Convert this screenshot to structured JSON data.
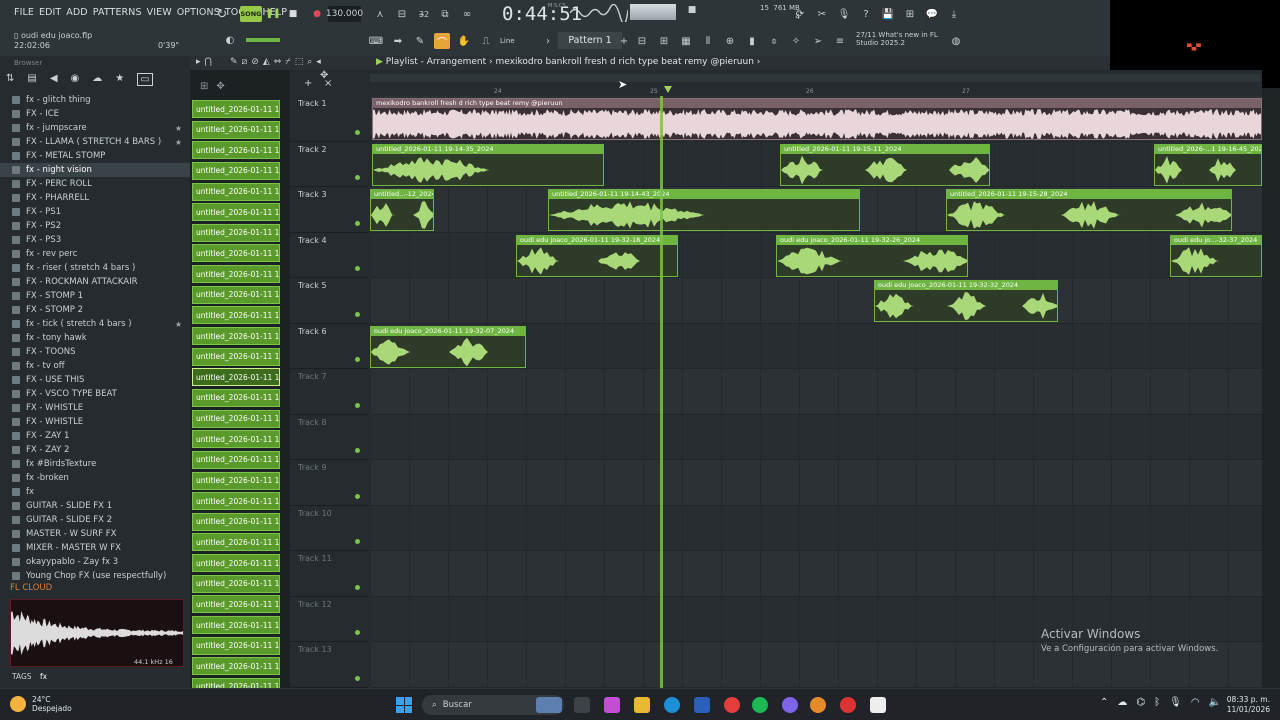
{
  "menu": [
    "FILE",
    "EDIT",
    "ADD",
    "PATTERNS",
    "VIEW",
    "OPTIONS",
    "TOOLS",
    "HELP"
  ],
  "project": {
    "name": "oudi edu joaco.flp",
    "time": "22:02:06",
    "elapsed": "0'39\""
  },
  "transport": {
    "mode_label": "SONG",
    "tempo": "130.000",
    "time_display": "0:44:51",
    "time_unit_label": "M:S:CS"
  },
  "status": {
    "cpu": "15",
    "ram": "761 MB",
    "voices": "4"
  },
  "pattern": "Pattern 1",
  "snap": "Line",
  "news": {
    "line1": "27/11  What's new in FL",
    "line2": "Studio 2025.2"
  },
  "browser": {
    "title": "Browser",
    "items": [
      {
        "label": "fx - glitch thing",
        "star": false
      },
      {
        "label": "FX - ICE",
        "star": false
      },
      {
        "label": "fx - jumpscare",
        "star": true
      },
      {
        "label": "FX - LLAMA ( STRETCH 4 BARS )",
        "star": true
      },
      {
        "label": "FX - METAL STOMP",
        "star": false
      },
      {
        "label": "fx - night vision",
        "star": false,
        "selected": true
      },
      {
        "label": "FX - PERC ROLL",
        "star": false
      },
      {
        "label": "FX - PHARRELL",
        "star": false
      },
      {
        "label": "FX - PS1",
        "star": false
      },
      {
        "label": "FX - PS2",
        "star": false
      },
      {
        "label": "FX - PS3",
        "star": false
      },
      {
        "label": "fx - rev perc",
        "star": false
      },
      {
        "label": "fx - riser ( stretch 4 bars )",
        "star": false
      },
      {
        "label": "FX - ROCKMAN ATTACKAIR",
        "star": false
      },
      {
        "label": "FX - STOMP 1",
        "star": false
      },
      {
        "label": "FX - STOMP 2",
        "star": false
      },
      {
        "label": "fx - tick ( stretch 4 bars )",
        "star": true
      },
      {
        "label": "fx - tony hawk",
        "star": false
      },
      {
        "label": "FX - TOONS",
        "star": false
      },
      {
        "label": "fx - tv off",
        "star": false
      },
      {
        "label": "FX - USE THIS",
        "star": false
      },
      {
        "label": "FX - VSCO TYPE BEAT",
        "star": false
      },
      {
        "label": "FX - WHISTLE",
        "star": false
      },
      {
        "label": "FX - WHISTLE",
        "star": false
      },
      {
        "label": "FX - ZAY 1",
        "star": false
      },
      {
        "label": "FX - ZAY 2",
        "star": false
      },
      {
        "label": "fx #BirdsTexture",
        "star": false
      },
      {
        "label": "fx -broken",
        "star": false
      },
      {
        "label": "fx",
        "star": false
      },
      {
        "label": "GUITAR - SLIDE FX 1",
        "star": false
      },
      {
        "label": "GUITAR - SLIDE FX 2",
        "star": false
      },
      {
        "label": "MASTER - W SURF FX",
        "star": false
      },
      {
        "label": "MIXER - MASTER W FX",
        "star": false
      },
      {
        "label": "okayypablo - Zay fx 3",
        "star": false
      },
      {
        "label": "Young Chop FX (use respectfully)",
        "star": false
      }
    ],
    "cloud_label": "FL CLOUD",
    "sample_rate": "44.1 kHz 16",
    "tags_label": "TAGS",
    "tag_value": "fx"
  },
  "channels": {
    "label": "untitled_2026-01-11 19-...",
    "count": 29,
    "selected_index": 13
  },
  "playlist": {
    "title": "Playlist - Arrangement",
    "crumb": "mexikodro  bankroll fresh  d rich type beat remy @pieruun",
    "bars": [
      "24",
      "25",
      "26",
      "27"
    ],
    "tracks": [
      "Track 1",
      "Track 2",
      "Track 3",
      "Track 4",
      "Track 5",
      "Track 6",
      "Track 7",
      "Track 8",
      "Track 9",
      "Track 10",
      "Track 11",
      "Track 12",
      "Track 13"
    ],
    "clips": [
      {
        "track": 0,
        "label": "mexikodro  bankroll fresh  d rich type beat remy @pieruun",
        "kind": "pink"
      },
      {
        "track": 1,
        "label": "untitled_2026-01-11 19-14-35_2024",
        "kind": "green"
      },
      {
        "track": 1,
        "label": "untitled_2026-01-11 19-15-11_2024",
        "kind": "green"
      },
      {
        "track": 1,
        "label": "untitled_2026-...1 19-16-45_2024",
        "kind": "green"
      },
      {
        "track": 2,
        "label": "untitled...-12_2024",
        "kind": "green"
      },
      {
        "track": 2,
        "label": "untitled_2026-01-11 19-14-43_2024",
        "kind": "green"
      },
      {
        "track": 2,
        "label": "untitled_2026-01-11 19-15-28_2024",
        "kind": "green"
      },
      {
        "track": 3,
        "label": "oudi edu joaco_2026-01-11 19-32-18_2024",
        "kind": "green"
      },
      {
        "track": 3,
        "label": "oudi edu joaco_2026-01-11 19-32-26_2024",
        "kind": "green"
      },
      {
        "track": 3,
        "label": "oudi edu jo...-32-37_2024",
        "kind": "green"
      },
      {
        "track": 4,
        "label": "oudi edu joaco_2026-01-11 19-32-32_2024",
        "kind": "green"
      },
      {
        "track": 5,
        "label": "oudi edu joaco_2026-01-11 19-32-07_2024",
        "kind": "green"
      }
    ]
  },
  "watermark": {
    "line1": "Activar Windows",
    "line2": "Ve a Configuración para activar Windows."
  },
  "taskbar": {
    "temp": "24°C",
    "weather": "Despejado",
    "search": "Buscar",
    "time": "08:33 p. m.",
    "date": "11/01/2026"
  }
}
